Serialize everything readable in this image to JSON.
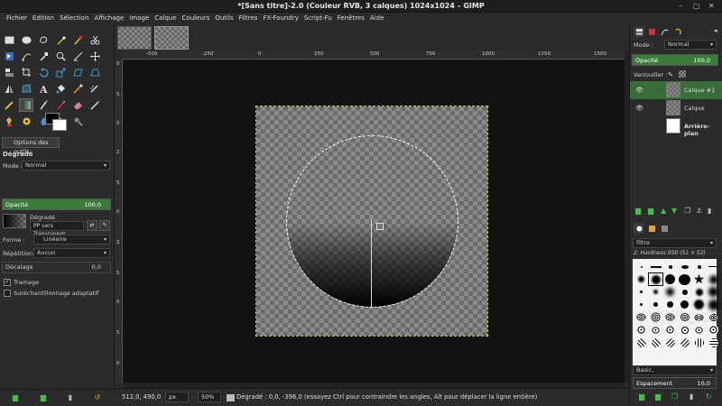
{
  "window": {
    "title": "*[Sans titre]-2.0 (Couleur RVB, 3 calques) 1024x1024 – GIMP",
    "buttons": [
      "–",
      "▢",
      "✕"
    ]
  },
  "menubar": [
    "Fichier",
    "Edition",
    "Sélection",
    "Affichage",
    "Image",
    "Calque",
    "Couleurs",
    "Outils",
    "Filtres",
    "FX-Foundry",
    "Script-Fu",
    "Fenêtres",
    "Aide"
  ],
  "tool_options": {
    "tab_label": "Options des outils",
    "title": "Dégradé",
    "mode_label": "Mode :",
    "mode_value": "Normal",
    "opacity_label": "Opacité",
    "opacity_value": "100,0",
    "gradient_label": "Dégradé",
    "gradient_name": "PP vers Transparent",
    "shape_label": "Forme :",
    "shape_value": "Linéaire",
    "repeat_label": "Répétition :",
    "repeat_value": "Aucun",
    "offset_label": "Décalage",
    "offset_value": "0,0",
    "dither_label": "Tramage",
    "dither_checked": true,
    "supersample_label": "Suréchantillonnage adaptatif",
    "supersample_checked": false
  },
  "rulers": {
    "top": [
      "-500",
      "-250",
      "0",
      "250",
      "500",
      "750",
      "1000",
      "1250",
      "1500"
    ],
    "left": [
      "0",
      "5",
      "0",
      "2",
      "5",
      "0",
      "2",
      "5",
      "0",
      "5",
      "0"
    ]
  },
  "statusbar": {
    "coords": "512,0, 490,0",
    "unit": "px",
    "zoom": "50%",
    "message": "Dégradé : 0,0, -396,0 (essayez Ctrl pour contraindre les angles, Alt pour déplacer la ligne entière)"
  },
  "layers_panel": {
    "mode_label": "Mode :",
    "mode_value": "Normal",
    "opacity_label": "Opacité",
    "opacity_value": "100,0",
    "lock_label": "Verrouiller :",
    "layers": [
      {
        "name": "Calque #1",
        "active": true,
        "visible": true
      },
      {
        "name": "Calque",
        "active": false,
        "visible": true
      },
      {
        "name": "Arrière-plan",
        "active": false,
        "visible": false
      }
    ]
  },
  "brushes_panel": {
    "tag_filter": "filtre",
    "brush_name": "2. Hardness 050 (51 × 52)",
    "preset": "Basic,",
    "spacing_label": "Espacement",
    "spacing_value": "10,0"
  },
  "colors": {
    "accent_green": "#3d7b3d",
    "foreground": "#000000",
    "background": "#ffffff"
  }
}
